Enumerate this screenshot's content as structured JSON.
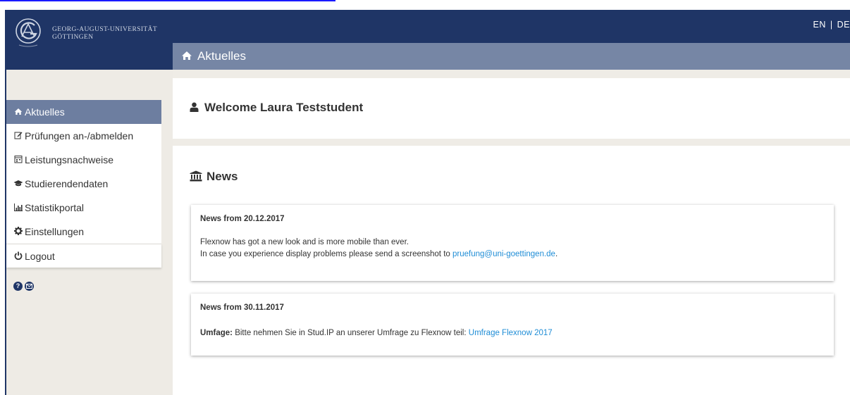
{
  "header": {
    "university_line1": "GEORG-AUGUST-UNIVERSITÄT",
    "university_line2": "GÖTTINGEN",
    "lang_en": "EN",
    "lang_separator": "|",
    "lang_de": "DE",
    "page_title": "Aktuelles"
  },
  "sidebar": {
    "items": [
      {
        "label": "Aktuelles",
        "icon": "home-icon"
      },
      {
        "label": "Prüfungen an-/abmelden",
        "icon": "edit-icon"
      },
      {
        "label": "Leistungsnachweise",
        "icon": "calendar-icon"
      },
      {
        "label": "Studierendendaten",
        "icon": "graduation-cap-icon"
      },
      {
        "label": "Statistikportal",
        "icon": "bar-chart-icon"
      },
      {
        "label": "Einstellungen",
        "icon": "gear-icon"
      }
    ],
    "logout": {
      "label": "Logout",
      "icon": "power-icon"
    },
    "help_icons": [
      "help-icon",
      "mail-icon"
    ]
  },
  "main": {
    "welcome": "Welcome Laura Teststudent",
    "news_heading": "News",
    "news": [
      {
        "date": "News from  20.12.2017",
        "line1": "Flexnow has got a new look and is more mobile than ever.",
        "line2_prefix": "In case you experience display problems please send a screenshot to ",
        "line2_link": "pruefung@uni-goettingen.de",
        "line2_suffix": "."
      },
      {
        "date": "News from  30.11.2017",
        "bold_prefix": "Umfage:",
        "text": " Bitte nehmen Sie in Stud.IP an unserer Umfrage zu Flexnow teil: ",
        "link": "Umfrage Flexnow 2017"
      }
    ]
  },
  "colors": {
    "header": "#1f3566",
    "heading_bar": "#7686a5",
    "active_nav": "#6d7ea0",
    "background": "#efece6",
    "link": "#1f8dd6"
  }
}
